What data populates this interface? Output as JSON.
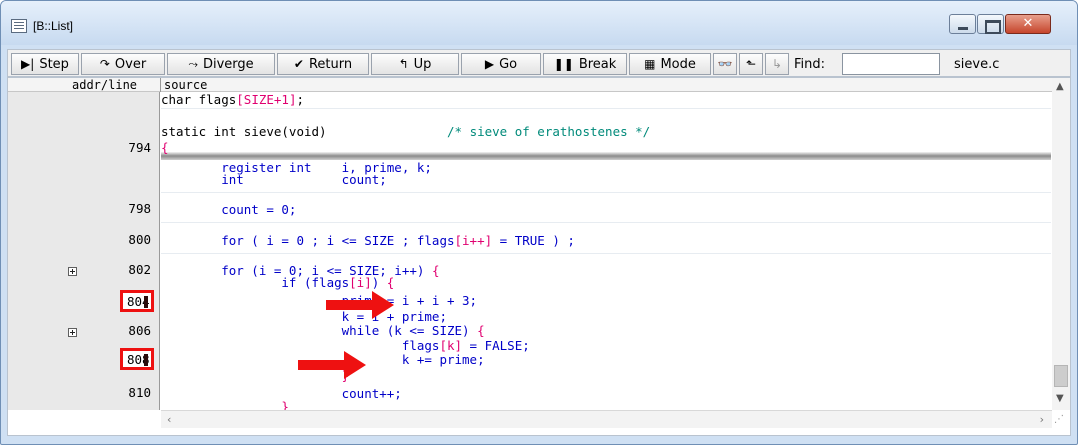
{
  "window": {
    "title": "[B::List]"
  },
  "toolbar": {
    "step": "Step",
    "over": "Over",
    "diverge": "Diverge",
    "return": "Return",
    "up": "Up",
    "go": "Go",
    "break": "Break",
    "mode": "Mode",
    "find_label": "Find:",
    "find_value": "",
    "file": "sieve.c"
  },
  "header": {
    "addr": "addr/line",
    "source": "source"
  },
  "line_numbers": [
    "794",
    "798",
    "800",
    "802",
    "806",
    "810"
  ],
  "breakpoints": [
    "804",
    "808"
  ],
  "source": {
    "l1a": "char flags",
    "l1b": "[SIZE+1]",
    "l1c": ";",
    "l2a": "static int sieve(void)",
    "l2b": "/* sieve of erathostenes */",
    "l3": "{",
    "l4a": "        register int    i, prime, k;",
    "l5a": "        int             count;",
    "l6": "        count = 0;",
    "l7a": "        for ( i = 0 ; i <= SIZE ; flags",
    "l7b": "[i++]",
    "l7c": " = TRUE ) ;",
    "l8a": "        for (i = 0; i <= SIZE; i++) ",
    "l8b": "{",
    "l9a": "                if (flags",
    "l9b": "[i]",
    "l9c": ") ",
    "l9d": "{",
    "l10": "                        prime = i + i + 3;",
    "l11": "                        k = i + prime;",
    "l12a": "                        while (k <= SIZE) ",
    "l12b": "{",
    "l13a": "                                flags",
    "l13b": "[k]",
    "l13c": " = FALSE;",
    "l14": "                                k += prime;",
    "l15": "                        }",
    "l16": "                        count++;",
    "l17": "                }"
  },
  "colors": {
    "keyword_blue": "#0000c8",
    "bracket_pink": "#e00070",
    "comment_teal": "#008a7a",
    "marker_red": "#ee1111"
  }
}
